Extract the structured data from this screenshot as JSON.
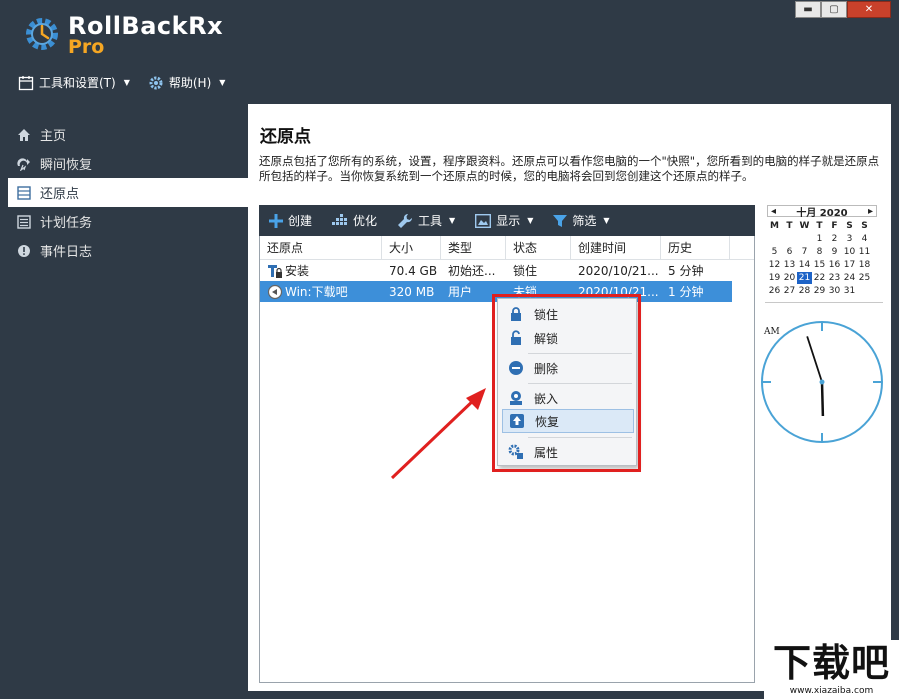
{
  "app": {
    "name": "RollBackRx",
    "edition": "Pro"
  },
  "window_controls": {
    "minimize": "▬",
    "maximize": "▢",
    "close": "✕"
  },
  "menubar": [
    {
      "label": "工具和设置(T)",
      "icon": "calendar-tools-icon"
    },
    {
      "label": "帮助(H)",
      "icon": "gear-icon"
    }
  ],
  "sidebar": {
    "items": [
      {
        "label": "主页",
        "icon": "home-icon",
        "active": false
      },
      {
        "label": "瞬间恢复",
        "icon": "instant-restore-icon",
        "active": false
      },
      {
        "label": "还原点",
        "icon": "list-icon",
        "active": true
      },
      {
        "label": "计划任务",
        "icon": "schedule-icon",
        "active": false
      },
      {
        "label": "事件日志",
        "icon": "warning-icon",
        "active": false
      }
    ]
  },
  "main": {
    "title": "还原点",
    "description": "还原点包括了您所有的系统，设置，程序跟资料。还原点可以看作您电脑的一个\"快照\"，您所看到的电脑的样子就是还原点所包括的样子。当你恢复系统到一个还原点的时候，您的电脑将会回到您创建这个还原点的样子。"
  },
  "toolbar": {
    "create": "创建",
    "optimize": "优化",
    "tools": "工具",
    "display": "显示",
    "filter": "筛选"
  },
  "grid": {
    "columns": [
      "还原点",
      "大小",
      "类型",
      "状态",
      "创建时间",
      "历史"
    ],
    "rows": [
      {
        "name": "安装",
        "size": "70.4 GB",
        "type": "初始还...",
        "status": "锁住",
        "created": "2020/10/21...",
        "history": "5 分钟",
        "selected": false
      },
      {
        "name": "Win:下载吧",
        "size": "320 MB",
        "type": "用户",
        "status": "未锁",
        "created": "2020/10/21...",
        "history": "1 分钟",
        "selected": true
      }
    ]
  },
  "context_menu": {
    "items": [
      {
        "label": "锁住",
        "icon": "lock-icon"
      },
      {
        "label": "解锁",
        "icon": "unlock-icon"
      },
      {
        "label": "删除",
        "icon": "delete-icon"
      },
      {
        "label": "嵌入",
        "icon": "mount-icon"
      },
      {
        "label": "恢复",
        "icon": "restore-icon",
        "highlighted": true
      },
      {
        "label": "属性",
        "icon": "properties-icon"
      }
    ]
  },
  "calendar": {
    "month_label": "十月 2020",
    "prev": "◂",
    "next": "▸",
    "weekdays": [
      "M",
      "T",
      "W",
      "T",
      "F",
      "S",
      "S"
    ],
    "days": [
      "",
      "",
      "",
      "1",
      "2",
      "3",
      "4",
      "5",
      "6",
      "7",
      "8",
      "9",
      "10",
      "11",
      "12",
      "13",
      "14",
      "15",
      "16",
      "17",
      "18",
      "19",
      "20",
      "21",
      "22",
      "23",
      "24",
      "25",
      "26",
      "27",
      "28",
      "29",
      "30",
      "31",
      ""
    ],
    "today": "21"
  },
  "clock": {
    "period": "AM",
    "hour": 5,
    "minute": 57
  },
  "watermark": {
    "text": "下载吧",
    "url": "www.xiazaiba.com"
  },
  "colors": {
    "chrome": "#2f3a46",
    "accent": "#3d8fd9",
    "brand_orange": "#f5a623",
    "highlight_red": "#e0201f"
  }
}
